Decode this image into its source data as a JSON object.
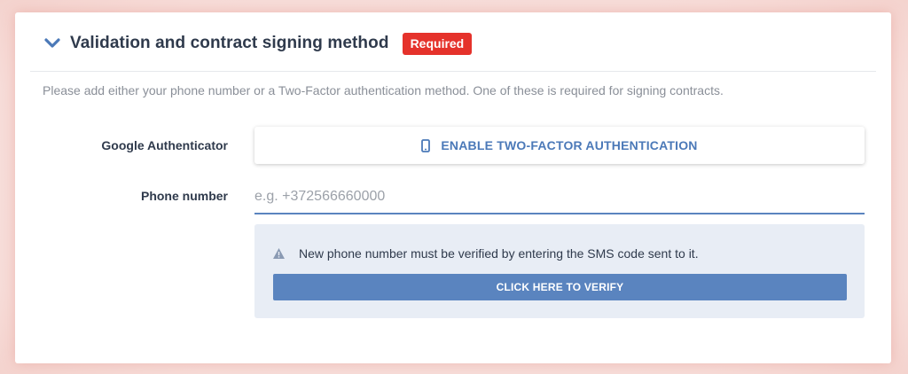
{
  "section": {
    "title": "Validation and contract signing method",
    "badge": "Required",
    "description": "Please add either your phone number or a Two-Factor authentication method. One of these is required for signing contracts."
  },
  "google_authenticator": {
    "label": "Google Authenticator",
    "button_label": "ENABLE TWO-FACTOR AUTHENTICATION",
    "icon": "mobile-phone-icon"
  },
  "phone": {
    "label": "Phone number",
    "value": "",
    "placeholder": "e.g. +372566660000"
  },
  "notice": {
    "icon": "warning-icon",
    "text": "New phone number must be verified by entering the SMS code sent to it.",
    "verify_button": "CLICK HERE TO VERIFY"
  },
  "colors": {
    "accent": "#5a84bf",
    "badge": "#e5322b",
    "text": "#2f3a4c",
    "notice_bg": "#e8edf5"
  }
}
